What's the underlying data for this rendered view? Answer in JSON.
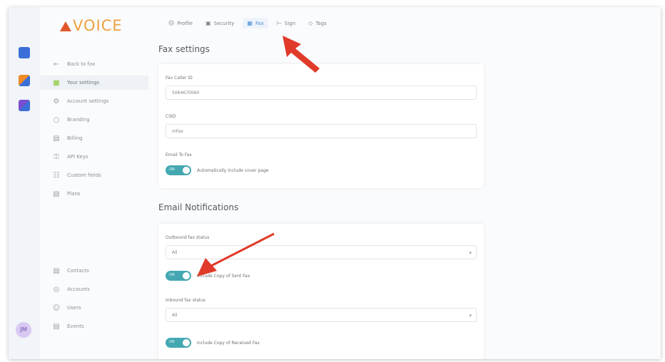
{
  "brand": {
    "name": "VOICE",
    "accent": "#e0562a",
    "text_color": "#f0a040"
  },
  "user": {
    "initials": "JM"
  },
  "sidebar": {
    "items": [
      {
        "label": "Back to fax",
        "icon": "arrow-left-icon"
      },
      {
        "label": "Your settings",
        "icon": "person-icon",
        "active": true
      },
      {
        "label": "Account settings",
        "icon": "gear-icon"
      },
      {
        "label": "Branding",
        "icon": "palette-icon"
      },
      {
        "label": "Billing",
        "icon": "billing-icon"
      },
      {
        "label": "API Keys",
        "icon": "key-icon"
      },
      {
        "label": "Custom fields",
        "icon": "fields-icon"
      },
      {
        "label": "Plans",
        "icon": "plans-icon"
      }
    ],
    "bottom_items": [
      {
        "label": "Contacts",
        "icon": "contacts-icon"
      },
      {
        "label": "Accounts",
        "icon": "accounts-icon"
      },
      {
        "label": "Users",
        "icon": "users-icon"
      },
      {
        "label": "Events",
        "icon": "events-icon"
      }
    ]
  },
  "tabs": [
    {
      "label": "Profile",
      "icon": "person-icon"
    },
    {
      "label": "Security",
      "icon": "lock-icon"
    },
    {
      "label": "Fax",
      "icon": "fax-icon",
      "active": true
    },
    {
      "label": "Sign",
      "icon": "sign-icon"
    },
    {
      "label": "Tags",
      "icon": "tag-icon"
    }
  ],
  "fax_settings": {
    "title": "Fax settings",
    "caller_id_label": "Fax Caller ID",
    "caller_id_value": "5064670060",
    "csid_label": "CSID",
    "csid_value": "mFax",
    "email_to_fax_label": "Email To Fax",
    "cover_page_toggle": {
      "on": true,
      "label": "Automatically include cover page"
    }
  },
  "email_notifications": {
    "title": "Email Notifications",
    "outbound_label": "Outbound fax status",
    "outbound_value": "All",
    "sent_copy_toggle": {
      "on": true,
      "label": "Include Copy of Sent Fax"
    },
    "inbound_label": "Inbound fax status",
    "inbound_value": "All",
    "received_copy_toggle": {
      "on": true,
      "label": "Include Copy of Received Fax"
    }
  },
  "toggle_on_text": "ON",
  "toggle_color": "#43a8b2",
  "annotation_color": "#e03a2a"
}
